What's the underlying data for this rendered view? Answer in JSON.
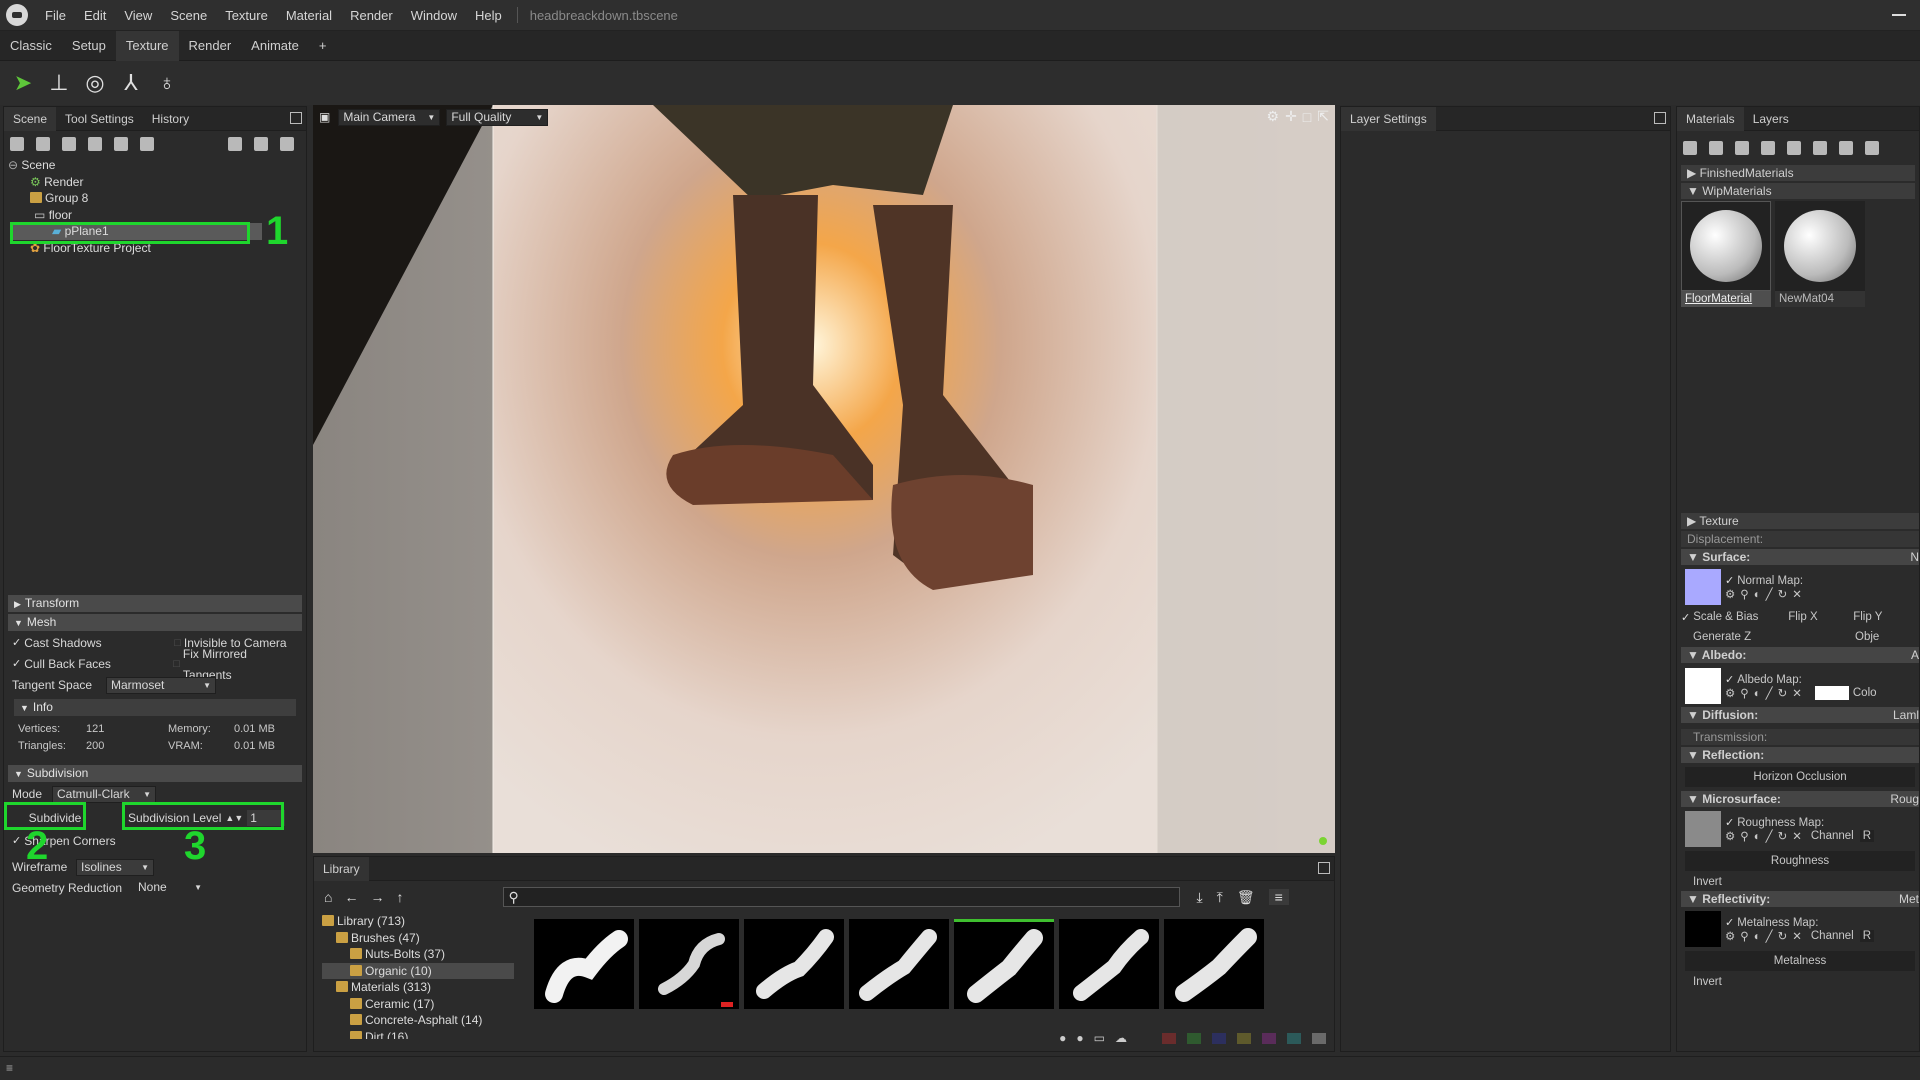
{
  "menubar": {
    "items": [
      "File",
      "Edit",
      "View",
      "Scene",
      "Texture",
      "Material",
      "Render",
      "Window",
      "Help"
    ],
    "filename": "headbreackdown.tbscene"
  },
  "tabs": [
    "Classic",
    "Setup",
    "Texture",
    "Render",
    "Animate",
    "+"
  ],
  "left_panel": {
    "tabs": [
      "Scene",
      "Tool Settings",
      "History"
    ],
    "tree": [
      "Scene",
      "Render",
      "Group 8",
      "floor",
      "pPlane1",
      "FloorTexture Project"
    ],
    "transform": "Transform",
    "mesh": {
      "title": "Mesh",
      "cast_shadows": "Cast Shadows",
      "invisible_to_camera": "Invisible to Camera",
      "cull_back_faces": "Cull Back Faces",
      "fix_mirrored": "Fix Mirrored Tangents",
      "tangent_space_label": "Tangent Space",
      "tangent_space_value": "Marmoset"
    },
    "info": {
      "title": "Info",
      "vertices_label": "Vertices:",
      "vertices": "121",
      "triangles_label": "Triangles:",
      "triangles": "200",
      "memory_label": "Memory:",
      "memory": "0.01 MB",
      "vram_label": "VRAM:",
      "vram": "0.01 MB"
    },
    "subdivision": {
      "title": "Subdivision",
      "mode_label": "Mode",
      "mode_value": "Catmull-Clark",
      "subdivide": "Subdivide",
      "level_label": "Subdivision Level",
      "level_value": "1",
      "sharpen": "Sharpen Corners",
      "wireframe_label": "Wireframe",
      "wireframe_value": "Isolines",
      "geo_label": "Geometry Reduction",
      "geo_value": "None"
    },
    "annotations": [
      "1",
      "2",
      "3"
    ]
  },
  "viewport": {
    "camera": "Main Camera",
    "quality": "Full Quality"
  },
  "layer_settings": {
    "title": "Layer Settings"
  },
  "library": {
    "title": "Library",
    "tree": [
      "Library (713)",
      "Brushes (47)",
      "Nuts-Bolts (37)",
      "Organic (10)",
      "Materials (313)",
      "Ceramic (17)",
      "Concrete-Asphalt (14)",
      "Dirt (16)"
    ],
    "swatch_colors": [
      "#6a2c2c",
      "#2f5a2f",
      "#2c2f5e",
      "#5e5a2c",
      "#5a2c5a",
      "#2c5a5a",
      "#6a6a6a"
    ]
  },
  "right_panel": {
    "tabs": [
      "Materials",
      "Layers"
    ],
    "finished": "FinishedMaterials",
    "wip": "WipMaterials",
    "materials": [
      "FloorMaterial",
      "NewMat04"
    ],
    "texture": "Texture",
    "displacement": "Displacement:",
    "surface": "Surface:",
    "surface_r": "N",
    "normal_map": "Normal Map:",
    "scale_bias": "Scale & Bias",
    "flip_x": "Flip X",
    "flip_y": "Flip Y",
    "generate_z": "Generate Z",
    "obj": "Obje",
    "albedo": "Albedo:",
    "albedo_r": "A",
    "albedo_map": "Albedo Map:",
    "color": "Colo",
    "diffusion": "Diffusion:",
    "diffusion_r": "Laml",
    "transmission": "Transmission:",
    "reflection": "Reflection:",
    "horizon": "Horizon Occlusion",
    "microsurface": "Microsurface:",
    "microsurface_r": "Roug",
    "roughness_map": "Roughness Map:",
    "channel": "Channel",
    "channel_r": "R",
    "roughness": "Roughness",
    "invert": "Invert",
    "reflectivity": "Reflectivity:",
    "reflectivity_r": "Met",
    "metalness_map": "Metalness Map:",
    "metalness": "Metalness"
  }
}
